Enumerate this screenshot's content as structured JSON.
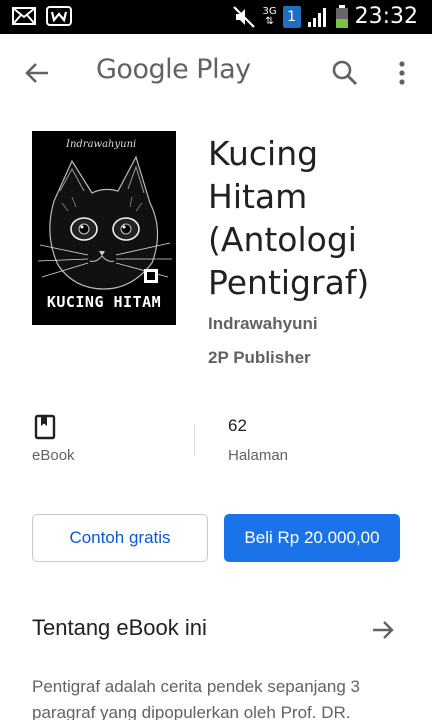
{
  "status_bar": {
    "time": "23:32",
    "network": "3G",
    "sim": "1",
    "icons": [
      "mail-icon",
      "w-app-icon",
      "mute-icon",
      "network-3g-icon",
      "sim-icon",
      "signal-icon",
      "battery-icon"
    ]
  },
  "app_bar": {
    "title": "Google Play",
    "icons": [
      "back-arrow-icon",
      "search-icon",
      "more-vert-icon"
    ]
  },
  "book": {
    "title": "Kucing Hitam (Antologi Pentigraf)",
    "author": "Indrawahyuni",
    "publisher": "2P Publisher",
    "cover": {
      "author_text": "Indrawahyuni",
      "title_text": "KUCING HITAM"
    }
  },
  "info": {
    "format_label": "eBook",
    "pages_value": "62",
    "pages_label": "Halaman"
  },
  "actions": {
    "sample_label": "Contoh gratis",
    "buy_label": "Beli Rp 20.000,00"
  },
  "about": {
    "title": "Tentang eBook ini",
    "text": "Pentigraf adalah cerita pendek sepanjang 3 paragraf yang dipopulerkan oleh Prof. DR."
  },
  "colors": {
    "accent": "#1a73e8",
    "link": "#0b57d0",
    "secondary_text": "#5f6368",
    "primary_text": "#202124"
  }
}
